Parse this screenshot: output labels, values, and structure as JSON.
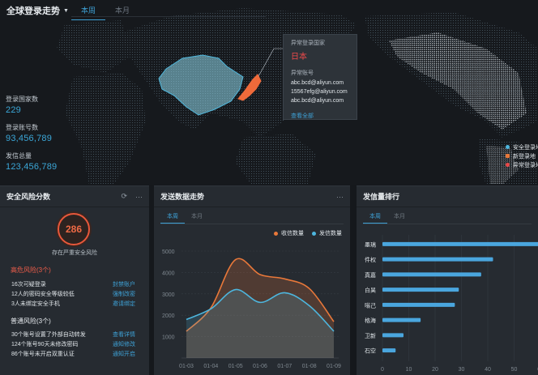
{
  "header": {
    "title": "全球登录走势",
    "tabs": [
      "本周",
      "本月"
    ]
  },
  "stats": [
    {
      "label": "登录国家数",
      "value": "229"
    },
    {
      "label": "登录账号数",
      "value": "93,456,789"
    },
    {
      "label": "发信总量",
      "value": "123,456,789"
    }
  ],
  "popup": {
    "title": "异常登录国家",
    "country": "日本",
    "accounts_label": "异常账号",
    "accounts": [
      "abc.bcd@aliyun.com",
      "15567efg@aliyun.com",
      "abc.bcd@aliyun.com"
    ],
    "link": "查看全部"
  },
  "map_legend": [
    {
      "label": "安全登录地",
      "color": "#4db6de"
    },
    {
      "label": "新登录地",
      "color": "#e8783a"
    },
    {
      "label": "异常登录地",
      "color": "#e94848"
    }
  ],
  "risk_panel": {
    "title": "安全风险分数",
    "score": "286",
    "score_label": "存在严重安全风险",
    "high_title": "高危风险(3个)",
    "high_items": [
      {
        "text": "16次可疑登录",
        "action": "封禁账户"
      },
      {
        "text": "12人的密码安全等级较低",
        "action": "强制改密"
      },
      {
        "text": "3人未绑定安全手机",
        "action": "邀请绑定"
      }
    ],
    "normal_title": "普通风险(3个)",
    "normal_items": [
      {
        "text": "30个账号设置了外部自动转发",
        "action": "查看详情"
      },
      {
        "text": "124个账号90天未修改密码",
        "action": "通知修改"
      },
      {
        "text": "86个账号未开启双重认证",
        "action": "通知开启"
      }
    ]
  },
  "trend_panel": {
    "title": "发送数据走势",
    "tabs": [
      "本周",
      "本月"
    ]
  },
  "rank_panel": {
    "title": "发信量排行",
    "tabs": [
      "本周",
      "本月"
    ]
  },
  "chart_data": [
    {
      "type": "area",
      "title": "发送数据走势",
      "x": [
        "01-03",
        "01-04",
        "01-05",
        "01-06",
        "01-07",
        "01-08",
        "01-09"
      ],
      "ylim": [
        0,
        5000
      ],
      "yticks": [
        1000,
        2000,
        3000,
        4000,
        5000
      ],
      "legend": "top-right",
      "series": [
        {
          "name": "收信数量",
          "color": "#e8783a",
          "values": [
            1250,
            2350,
            4600,
            3900,
            3700,
            3250,
            1700
          ]
        },
        {
          "name": "发信数量",
          "color": "#4db6de",
          "values": [
            1800,
            2300,
            3200,
            2600,
            3050,
            2450,
            1250
          ]
        }
      ]
    },
    {
      "type": "bar",
      "title": "发信量排行",
      "categories": [
        "墨璃",
        "件权",
        "真嘉",
        "白昊",
        "嗡己",
        "格海",
        "卫新",
        "石空"
      ],
      "values": [
        63,
        42,
        37.5,
        29,
        27.5,
        14.5,
        8,
        5
      ],
      "xlim": [
        0,
        60
      ],
      "xticks": [
        0,
        10,
        20,
        30,
        40,
        50,
        60
      ]
    }
  ]
}
